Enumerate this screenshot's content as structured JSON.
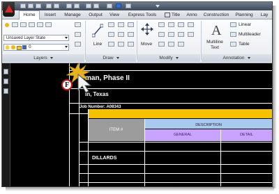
{
  "quick_access": {
    "icons": [
      "new-icon",
      "open-icon",
      "save-icon",
      "undo-icon",
      "redo-icon",
      "plot-icon",
      "print-icon",
      "copy-icon",
      "paste-icon",
      "properties-icon",
      "selected-icon",
      "workspace-icon"
    ]
  },
  "tabs": [
    {
      "label": "Home",
      "active": true
    },
    {
      "label": "Insert",
      "active": false
    },
    {
      "label": "Manage",
      "active": false
    },
    {
      "label": "Output",
      "active": false
    },
    {
      "label": "View",
      "active": false
    },
    {
      "label": "Express Tools",
      "active": false
    },
    {
      "label": "Title",
      "active": false
    },
    {
      "label": "Anno",
      "active": false
    },
    {
      "label": "Construction",
      "active": false
    },
    {
      "label": "Planning",
      "active": false
    },
    {
      "label": "Lay",
      "active": false
    }
  ],
  "ribbon": {
    "layer_state": "Unsaved Layer State",
    "layer_value": "0",
    "layers_panel": "Layers",
    "draw_panel": "Draw",
    "modify_panel": "Modify",
    "annotation_panel": "Annotation",
    "line_label": "Line",
    "move_label": "Move",
    "multiline_label": "Multiline",
    "multiline_label2": "Text",
    "linear_label": "Linear",
    "multileader_label": "Multileader",
    "table_label": "Table",
    "multiline_glyph": "A"
  },
  "drawing": {
    "title_line1": "man, Phase II",
    "title_line2": "in, Texas",
    "job_number": "Job Number: A08343",
    "item_header": "ITEM #",
    "description_header": "DESCRIPTION",
    "general_header": "GENERAL",
    "detail_header": "DETAIL",
    "row_label": "DILLARDS",
    "callout_letter": "F"
  },
  "colors": {
    "header_yellow": "#f6c200",
    "header_gray": "#9c9c9c",
    "header_blue": "#a9c9ef",
    "header_purple": "#c9a4ff",
    "callout_red": "#cc1616",
    "starburst_gold": "#e7b21f"
  }
}
